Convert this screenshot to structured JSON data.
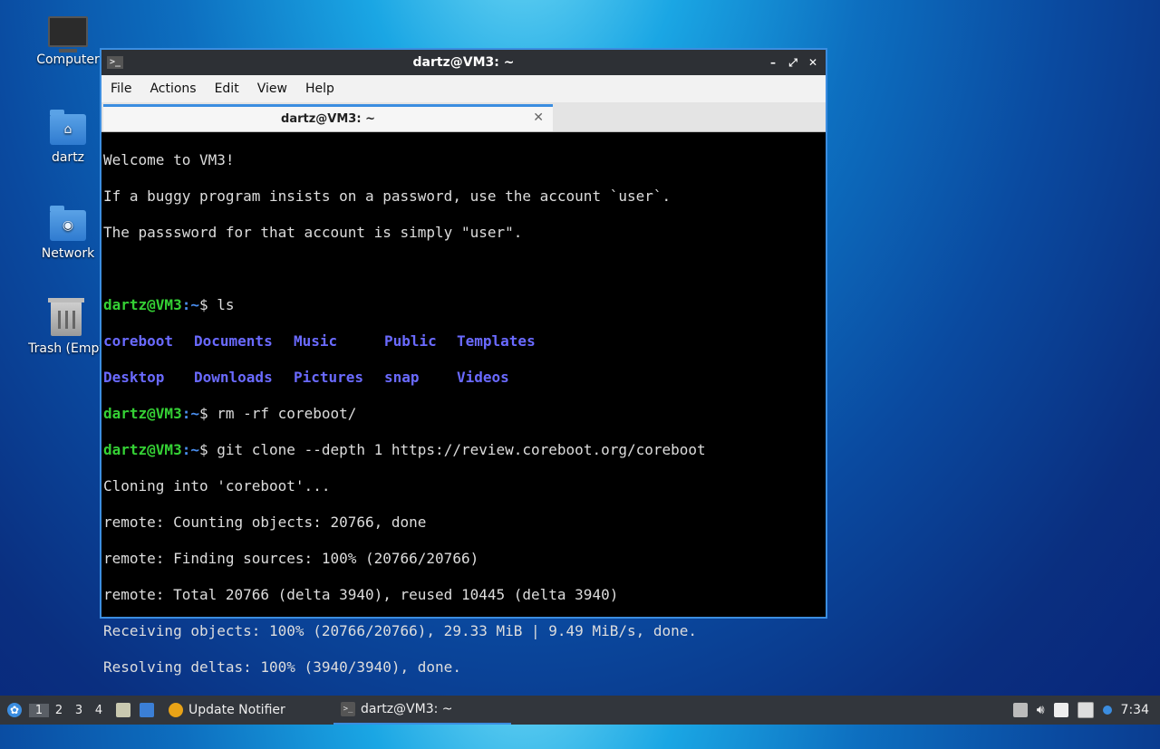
{
  "desktop": {
    "icons": [
      {
        "label": "Computer"
      },
      {
        "label": "dartz"
      },
      {
        "label": "Network"
      },
      {
        "label": "Trash (Empt"
      }
    ]
  },
  "window": {
    "title": "dartz@VM3: ~",
    "menu": [
      "File",
      "Actions",
      "Edit",
      "View",
      "Help"
    ],
    "tab_title": "dartz@VM3: ~",
    "controls": {
      "minimize": "–",
      "maximize": "⤢",
      "close": "✕"
    }
  },
  "terminal": {
    "prompt_user": "dartz@VM3",
    "prompt_path": ":~",
    "prompt_sign": "$ ",
    "welcome": [
      "Welcome to VM3!",
      "If a buggy program insists on a password, use the account `user`.",
      "The passsword for that account is simply \"user\"."
    ],
    "cmd1": "ls",
    "ls_row1": [
      "coreboot",
      "Documents",
      "Music",
      "Public",
      "Templates"
    ],
    "ls_row2": [
      "Desktop",
      "Downloads",
      "Pictures",
      "snap",
      "Videos"
    ],
    "cmd2": "rm -rf coreboot/",
    "cmd3": "git clone --depth 1 https://review.coreboot.org/coreboot",
    "output": [
      "Cloning into 'coreboot'...",
      "remote: Counting objects: 20766, done",
      "remote: Finding sources: 100% (20766/20766)",
      "remote: Total 20766 (delta 3940), reused 10445 (delta 3940)",
      "Receiving objects: 100% (20766/20766), 29.33 MiB | 9.49 MiB/s, done.",
      "Resolving deltas: 100% (3940/3940), done."
    ]
  },
  "taskbar": {
    "workspaces": [
      "1",
      "2",
      "3",
      "4"
    ],
    "tasks": [
      {
        "label": "Update Notifier"
      },
      {
        "label": "dartz@VM3: ~"
      }
    ],
    "clock": "7:34"
  }
}
